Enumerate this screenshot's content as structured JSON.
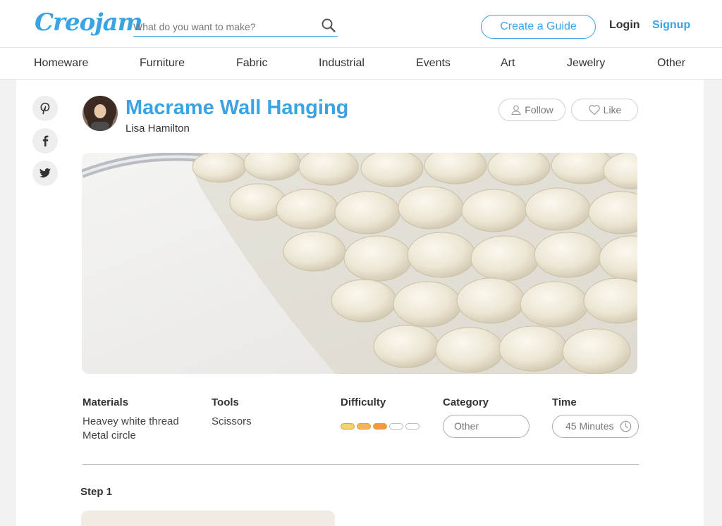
{
  "header": {
    "logo": "Creojam",
    "search": {
      "placeholder": "What do you want to make?"
    },
    "create_label": "Create a Guide",
    "login_label": "Login",
    "signup_label": "Signup"
  },
  "nav": [
    "Homeware",
    "Furniture",
    "Fabric",
    "Industrial",
    "Events",
    "Art",
    "Jewelry",
    "Other"
  ],
  "guide": {
    "title": "Macrame Wall Hanging",
    "author": "Lisa Hamilton",
    "follow_label": "Follow",
    "like_label": "Like"
  },
  "info": {
    "materials_label": "Materials",
    "materials": [
      "Heavey white thread",
      "Metal circle"
    ],
    "tools_label": "Tools",
    "tools": [
      "Scissors"
    ],
    "difficulty_label": "Difficulty",
    "difficulty_level": 3,
    "difficulty_max": 5,
    "category_label": "Category",
    "category_value": "Other",
    "time_label": "Time",
    "time_value": "45 Minutes"
  },
  "step": {
    "label": "Step 1"
  },
  "colors": {
    "accent": "#3aa3e3",
    "difficulty": [
      "#f5d36b",
      "#f5b455",
      "#f39a3e"
    ]
  },
  "icons": [
    "search-icon",
    "pinterest-icon",
    "facebook-icon",
    "twitter-icon",
    "user-icon",
    "heart-icon",
    "clock-icon"
  ]
}
